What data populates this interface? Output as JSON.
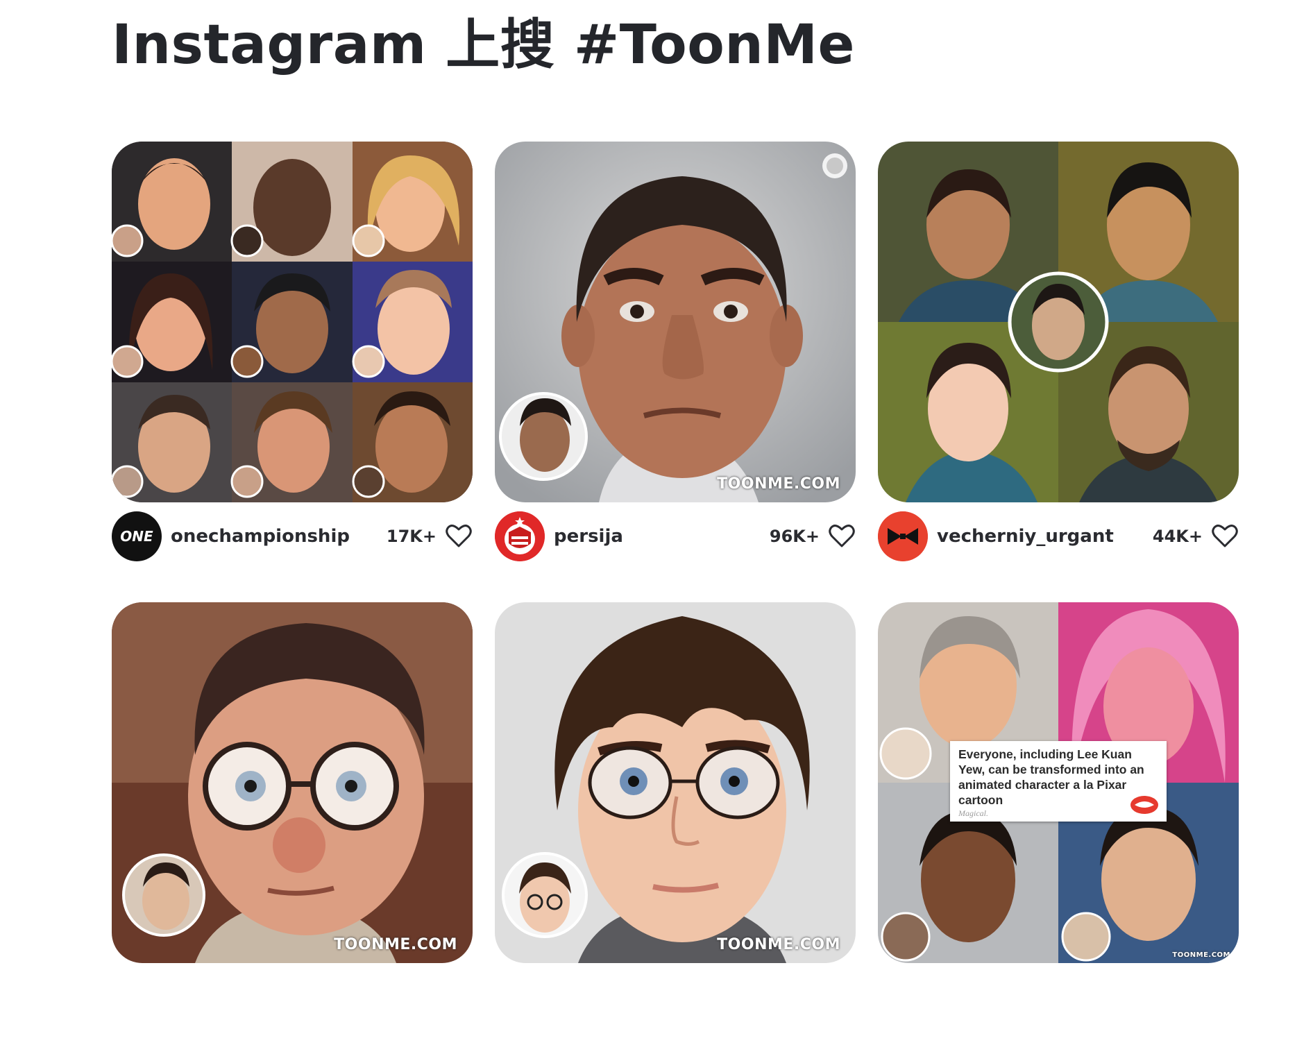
{
  "title": "Instagram 上搜 #ToonMe",
  "posts": [
    {
      "username": "onechampionship",
      "likes": "17K+",
      "avatar_text": "ONE",
      "avatar_color": "#111111"
    },
    {
      "username": "persija",
      "likes": "96K+",
      "avatar_color": "#e02828",
      "watermark": "TOONME.COM"
    },
    {
      "username": "vecherniy_urgant",
      "likes": "44K+",
      "avatar_color": "#e8412e"
    },
    {
      "watermark": "TOONME.COM"
    },
    {
      "watermark": "TOONME.COM"
    },
    {
      "watermark": "TOONME.COM",
      "caption": "Everyone, including Lee Kuan Yew, can be transformed into an animated character a la Pixar cartoon",
      "caption_sub": "Magical."
    }
  ],
  "colors": {
    "text": "#24262b",
    "heart_stroke": "#2a2b30"
  }
}
